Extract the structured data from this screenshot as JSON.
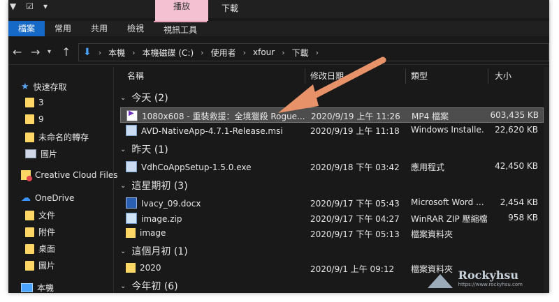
{
  "titlebar": {
    "contextual_tab": "播放",
    "title": "下載"
  },
  "ribbon": {
    "tabs": [
      "檔案",
      "常用",
      "共用",
      "檢視",
      "視訊工具"
    ]
  },
  "address": {
    "path": [
      "本機",
      "本機磁碟 (C:)",
      "使用者",
      "xfour",
      "下載"
    ]
  },
  "sidebar": {
    "items": [
      {
        "label": "快速存取",
        "icon": "star-icon"
      },
      {
        "label": "3",
        "icon": "folder-icon"
      },
      {
        "label": "9",
        "icon": "folder-icon"
      },
      {
        "label": "未命名的轉存",
        "icon": "folder-icon"
      },
      {
        "label": "圖片",
        "icon": "pictures-icon"
      },
      {
        "label": "Creative Cloud Files",
        "icon": "creative-cloud-icon"
      },
      {
        "label": "OneDrive",
        "icon": "cloud-icon"
      },
      {
        "label": "文件",
        "icon": "folder-icon"
      },
      {
        "label": "附件",
        "icon": "folder-icon"
      },
      {
        "label": "桌面",
        "icon": "folder-icon"
      },
      {
        "label": "圖片",
        "icon": "folder-icon"
      },
      {
        "label": "本機",
        "icon": "pc-icon"
      }
    ]
  },
  "columns": {
    "name": "名稱",
    "modified": "修改日期",
    "type": "類型",
    "size": "大小"
  },
  "groups": [
    {
      "label": "今天 (2)"
    },
    {
      "label": "昨天 (1)"
    },
    {
      "label": "這星期初 (3)"
    },
    {
      "label": "這個月初 (1)"
    },
    {
      "label": "今年初 (6)"
    }
  ],
  "files": [
    {
      "name": "1080x608 - 重裝救援：全境獵殺 Rogue...",
      "date": "2020/9/19 上午 11:26",
      "type": "MP4 檔案",
      "size": "603,435 KB",
      "icon": "video-file-icon"
    },
    {
      "name": "AVD-NativeApp-4.7.1-Release.msi",
      "date": "2020/9/19 上午 11:18",
      "type": "Windows Installe...",
      "size": "22,620 KB",
      "icon": "installer-icon"
    },
    {
      "name": "VdhCoAppSetup-1.5.0.exe",
      "date": "2020/9/18 下午 03:42",
      "type": "應用程式",
      "size": "42,450 KB",
      "icon": "installer-icon"
    },
    {
      "name": "Ivacy_09.docx",
      "date": "2020/9/17 下午 05:43",
      "type": "Microsoft Word ...",
      "size": "2,454 KB",
      "icon": "word-file-icon"
    },
    {
      "name": "image.zip",
      "date": "2020/9/17 下午 04:27",
      "type": "WinRAR ZIP 壓縮檔",
      "size": "958 KB",
      "icon": "zip-file-icon"
    },
    {
      "name": "image",
      "date": "2020/9/17 下午 05:13",
      "type": "檔案資料夾",
      "size": "",
      "icon": "folder-icon"
    },
    {
      "name": "2020",
      "date": "2020/9/1 上午 09:12",
      "type": "檔案資料夾",
      "size": "",
      "icon": "folder-icon"
    }
  ],
  "watermark": {
    "brand": "Rockyhsu",
    "url": "https://www.rockyhsu.com"
  },
  "colors": {
    "file_tab": "#1769c8",
    "context_tab": "#f3c1d2",
    "arrow": "#e8926a",
    "background": "#191919"
  }
}
